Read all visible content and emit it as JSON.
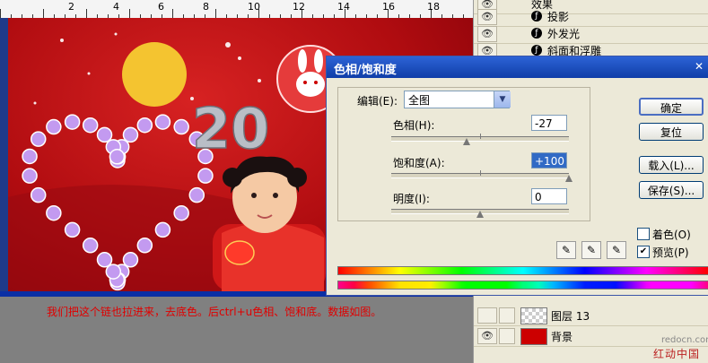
{
  "ruler": {
    "numbers": [
      "2",
      "4",
      "6",
      "8",
      "10",
      "12",
      "14",
      "16",
      "18"
    ]
  },
  "caption": "我们把这个链也拉进来，去底色。后ctrl+u色相、饱和底。数据如图。",
  "canvas": {
    "year_text": "20"
  },
  "layers": {
    "effects": [
      "效果",
      "投影",
      "外发光",
      "斜面和浮雕"
    ],
    "rows": [
      {
        "name": "图层 13",
        "visible": false,
        "icon": "checker-thumbnail"
      },
      {
        "name": "背景",
        "visible": true,
        "icon": "red-thumbnail"
      }
    ]
  },
  "watermark": {
    "url": "redocn.com",
    "brand": "红动中国"
  },
  "dialog": {
    "title": "色相/饱和度",
    "edit_label": "编辑(E):",
    "edit_value": "全图",
    "hue_label": "色相(H):",
    "hue_value": "-27",
    "saturation_label": "饱和度(A):",
    "saturation_value": "+100",
    "lightness_label": "明度(I):",
    "lightness_value": "0",
    "hue_fraction": 0.425,
    "saturation_fraction": 1.0,
    "lightness_fraction": 0.5,
    "buttons": {
      "ok": "确定",
      "reset": "复位",
      "load": "载入(L)...",
      "save": "保存(S)..."
    },
    "colorize_label": "着色(O)",
    "colorize_checked": false,
    "preview_label": "预览(P)",
    "preview_checked": true
  },
  "colors": {
    "title_bar": "#0f3ea8",
    "canvas_red": "#c4101a",
    "caption_red": "#e00000"
  }
}
